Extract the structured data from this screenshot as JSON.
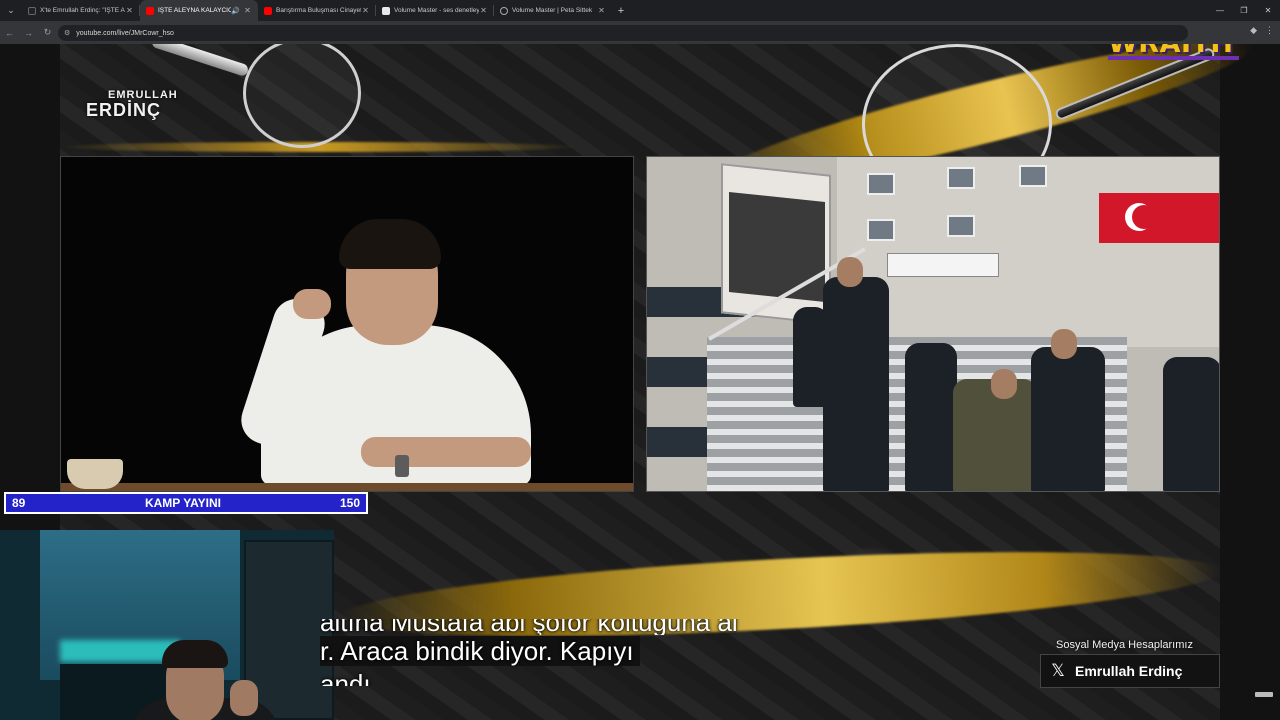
{
  "browser": {
    "tabs": [
      {
        "title": "X'te Emrullah Erdinç: \"İŞTE ALEY",
        "favicon_color": "#222222",
        "active": false
      },
      {
        "title": "İŞTE ALEYNA KALAYCIOĞLU",
        "favicon_color": "#ff0000",
        "active": true
      },
      {
        "title": "Barıştırma Buluşması Cinayetle",
        "favicon_color": "#ff0000",
        "active": false
      },
      {
        "title": "Volume Master - ses denetleyici",
        "favicon_color": "#e8e8e8",
        "active": false
      },
      {
        "title": "Volume Master | Peta Sittek",
        "favicon_color": "#888888",
        "active": false
      }
    ],
    "url": "youtube.com/live/JMrCowr_hso"
  },
  "stream": {
    "channel_brand_top": "EMRULLAH",
    "channel_brand_bottom": "ERDİNÇ",
    "sponsor": "WRAITH",
    "scoreboard": {
      "left": "89",
      "title": "KAMP YAYINI",
      "right": "150"
    },
    "subtitles": {
      "line1": "altına Mustafa abi şoför koltuğuna al",
      "line2": "r. Araca bindik diyor. Kapıyı",
      "line3": "andı"
    },
    "social": {
      "title": "Sosyal Medya Hesaplarımız",
      "handle": "Emrullah Erdinç",
      "icon": "x-icon"
    }
  },
  "colors": {
    "accent_gold": "#e9c24a",
    "scoreboard_blue": "#2323c9",
    "sponsor_yellow": "#f2c21b",
    "flag_red": "#d3172a"
  }
}
